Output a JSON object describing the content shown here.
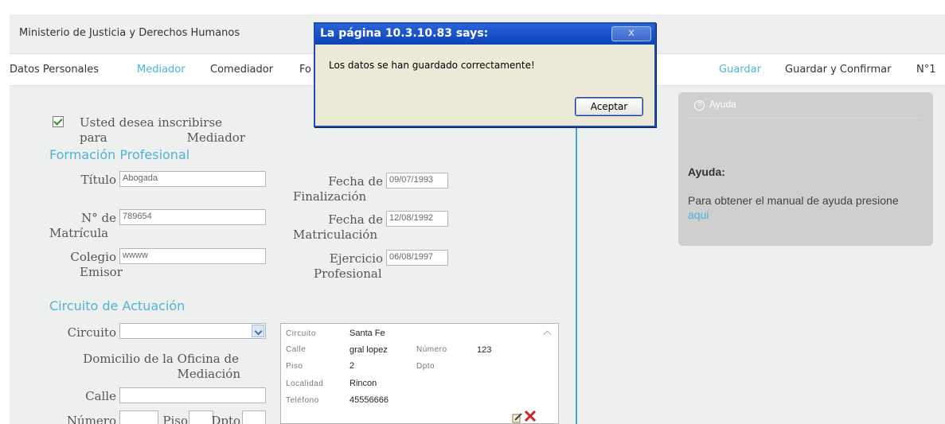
{
  "header": {
    "org": "Ministerio de Justicia y Derechos Humanos"
  },
  "tabs": {
    "items": [
      "Datos Personales",
      "Mediador",
      "Comediador",
      "Fo"
    ],
    "active_index": 1,
    "actions": [
      "Guardar",
      "Guardar y Confirmar",
      "N°1"
    ]
  },
  "form": {
    "checkbox_checked": true,
    "checkbox_label_1": "Usted desea inscribirse para",
    "checkbox_label_2": "Mediador",
    "formacion_title": "Formación Profesional",
    "titulo_label": "Título",
    "titulo_value": "Abogada",
    "matricula_label_1": "N° de",
    "matricula_label_2": "Matrícula",
    "matricula_value": "789654",
    "colegio_label_1": "Colegio",
    "colegio_label_2": "Emisor",
    "colegio_value": "wwww",
    "fecha_fin_label_1": "Fecha de",
    "fecha_fin_label_2": "Finalización",
    "fecha_fin_value": "09/07/1993",
    "fecha_mat_label_1": "Fecha de",
    "fecha_mat_label_2": "Matriculación",
    "fecha_mat_value": "12/08/1992",
    "ejercicio_label_1": "Ejercicio",
    "ejercicio_label_2": "Profesional",
    "ejercicio_value": "06/08/1997",
    "circuito_title": "Circuito de Actuación",
    "circuito_label": "Circuito",
    "circuito_value": "",
    "domicilio_label_1": "Domicilio de la Oficina de",
    "domicilio_label_2": "Mediación",
    "calle_label": "Calle",
    "calle_value": "",
    "numero_label": "Número",
    "piso_label": "Piso",
    "dpto_label": "Dpto"
  },
  "address": {
    "circuito_key": "Circuito",
    "circuito_val": "Santa Fe",
    "calle_key": "Calle",
    "calle_val": "gral lopez",
    "numero_key": "Número",
    "numero_val": "123",
    "piso_key": "Piso",
    "piso_val": "2",
    "dpto_key": "Dpto",
    "localidad_key": "Localidad",
    "localidad_val": "Rincon",
    "telefono_key": "Teléfono",
    "telefono_val": "45556666"
  },
  "help": {
    "header": "Ayuda",
    "title": "Ayuda:",
    "text": "Para obtener el manual de ayuda presione",
    "link": "aqui"
  },
  "dialog": {
    "title": "La página 10.3.10.83 says:",
    "close": "X",
    "message": "Los datos se han guardado correctamente!",
    "ok": "Aceptar"
  },
  "colors": {
    "accent": "#4fb3d4",
    "divider": "#46a8cc",
    "dialog_title": "#0d43b8"
  }
}
